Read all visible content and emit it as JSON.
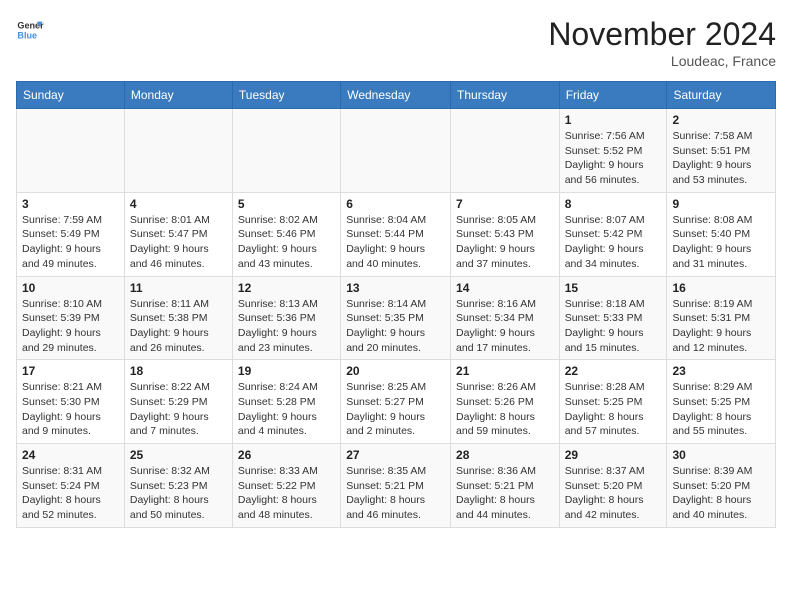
{
  "logo": {
    "line1": "General",
    "line2": "Blue"
  },
  "title": "November 2024",
  "location": "Loudeac, France",
  "days_of_week": [
    "Sunday",
    "Monday",
    "Tuesday",
    "Wednesday",
    "Thursday",
    "Friday",
    "Saturday"
  ],
  "weeks": [
    [
      {
        "day": "",
        "info": ""
      },
      {
        "day": "",
        "info": ""
      },
      {
        "day": "",
        "info": ""
      },
      {
        "day": "",
        "info": ""
      },
      {
        "day": "",
        "info": ""
      },
      {
        "day": "1",
        "info": "Sunrise: 7:56 AM\nSunset: 5:52 PM\nDaylight: 9 hours and 56 minutes."
      },
      {
        "day": "2",
        "info": "Sunrise: 7:58 AM\nSunset: 5:51 PM\nDaylight: 9 hours and 53 minutes."
      }
    ],
    [
      {
        "day": "3",
        "info": "Sunrise: 7:59 AM\nSunset: 5:49 PM\nDaylight: 9 hours and 49 minutes."
      },
      {
        "day": "4",
        "info": "Sunrise: 8:01 AM\nSunset: 5:47 PM\nDaylight: 9 hours and 46 minutes."
      },
      {
        "day": "5",
        "info": "Sunrise: 8:02 AM\nSunset: 5:46 PM\nDaylight: 9 hours and 43 minutes."
      },
      {
        "day": "6",
        "info": "Sunrise: 8:04 AM\nSunset: 5:44 PM\nDaylight: 9 hours and 40 minutes."
      },
      {
        "day": "7",
        "info": "Sunrise: 8:05 AM\nSunset: 5:43 PM\nDaylight: 9 hours and 37 minutes."
      },
      {
        "day": "8",
        "info": "Sunrise: 8:07 AM\nSunset: 5:42 PM\nDaylight: 9 hours and 34 minutes."
      },
      {
        "day": "9",
        "info": "Sunrise: 8:08 AM\nSunset: 5:40 PM\nDaylight: 9 hours and 31 minutes."
      }
    ],
    [
      {
        "day": "10",
        "info": "Sunrise: 8:10 AM\nSunset: 5:39 PM\nDaylight: 9 hours and 29 minutes."
      },
      {
        "day": "11",
        "info": "Sunrise: 8:11 AM\nSunset: 5:38 PM\nDaylight: 9 hours and 26 minutes."
      },
      {
        "day": "12",
        "info": "Sunrise: 8:13 AM\nSunset: 5:36 PM\nDaylight: 9 hours and 23 minutes."
      },
      {
        "day": "13",
        "info": "Sunrise: 8:14 AM\nSunset: 5:35 PM\nDaylight: 9 hours and 20 minutes."
      },
      {
        "day": "14",
        "info": "Sunrise: 8:16 AM\nSunset: 5:34 PM\nDaylight: 9 hours and 17 minutes."
      },
      {
        "day": "15",
        "info": "Sunrise: 8:18 AM\nSunset: 5:33 PM\nDaylight: 9 hours and 15 minutes."
      },
      {
        "day": "16",
        "info": "Sunrise: 8:19 AM\nSunset: 5:31 PM\nDaylight: 9 hours and 12 minutes."
      }
    ],
    [
      {
        "day": "17",
        "info": "Sunrise: 8:21 AM\nSunset: 5:30 PM\nDaylight: 9 hours and 9 minutes."
      },
      {
        "day": "18",
        "info": "Sunrise: 8:22 AM\nSunset: 5:29 PM\nDaylight: 9 hours and 7 minutes."
      },
      {
        "day": "19",
        "info": "Sunrise: 8:24 AM\nSunset: 5:28 PM\nDaylight: 9 hours and 4 minutes."
      },
      {
        "day": "20",
        "info": "Sunrise: 8:25 AM\nSunset: 5:27 PM\nDaylight: 9 hours and 2 minutes."
      },
      {
        "day": "21",
        "info": "Sunrise: 8:26 AM\nSunset: 5:26 PM\nDaylight: 8 hours and 59 minutes."
      },
      {
        "day": "22",
        "info": "Sunrise: 8:28 AM\nSunset: 5:25 PM\nDaylight: 8 hours and 57 minutes."
      },
      {
        "day": "23",
        "info": "Sunrise: 8:29 AM\nSunset: 5:25 PM\nDaylight: 8 hours and 55 minutes."
      }
    ],
    [
      {
        "day": "24",
        "info": "Sunrise: 8:31 AM\nSunset: 5:24 PM\nDaylight: 8 hours and 52 minutes."
      },
      {
        "day": "25",
        "info": "Sunrise: 8:32 AM\nSunset: 5:23 PM\nDaylight: 8 hours and 50 minutes."
      },
      {
        "day": "26",
        "info": "Sunrise: 8:33 AM\nSunset: 5:22 PM\nDaylight: 8 hours and 48 minutes."
      },
      {
        "day": "27",
        "info": "Sunrise: 8:35 AM\nSunset: 5:21 PM\nDaylight: 8 hours and 46 minutes."
      },
      {
        "day": "28",
        "info": "Sunrise: 8:36 AM\nSunset: 5:21 PM\nDaylight: 8 hours and 44 minutes."
      },
      {
        "day": "29",
        "info": "Sunrise: 8:37 AM\nSunset: 5:20 PM\nDaylight: 8 hours and 42 minutes."
      },
      {
        "day": "30",
        "info": "Sunrise: 8:39 AM\nSunset: 5:20 PM\nDaylight: 8 hours and 40 minutes."
      }
    ]
  ]
}
